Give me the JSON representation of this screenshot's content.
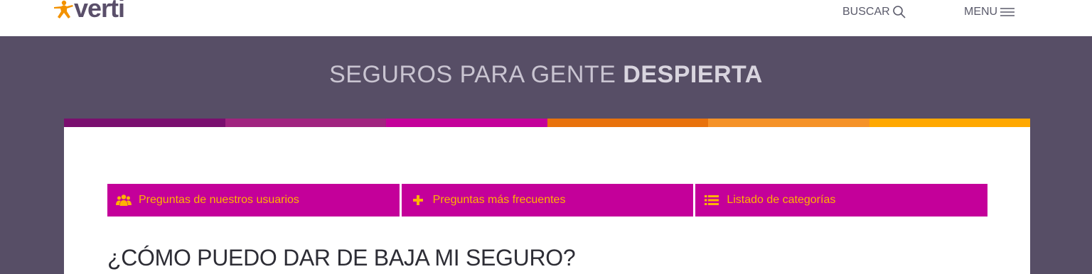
{
  "header": {
    "logo_text": "verti",
    "search_label": "BUSCAR",
    "menu_label": "MENU",
    "icons": {
      "search": "search-icon",
      "menu": "hamburger-menu-icon",
      "logo": "star-person-icon"
    }
  },
  "hero": {
    "title_light": "SEGUROS PARA GENTE ",
    "title_bold": "DESPIERTA"
  },
  "color_bar": [
    "#7a0f6f",
    "#a0247f",
    "#c4009a",
    "#e8720c",
    "#f59228",
    "#ffa800"
  ],
  "tabs": [
    {
      "label": "Preguntas de nuestros usuarios",
      "icon": "users-icon"
    },
    {
      "label": "Preguntas más frecuentes",
      "icon": "plus-icon"
    },
    {
      "label": "Listado de categorías",
      "icon": "list-icon"
    }
  ],
  "colors": {
    "accent": "#c4009a",
    "tab_text": "#ffb300",
    "hero_bg": "#574e66"
  },
  "page_title": "¿CÓMO PUEDO DAR DE BAJA MI SEGURO?"
}
